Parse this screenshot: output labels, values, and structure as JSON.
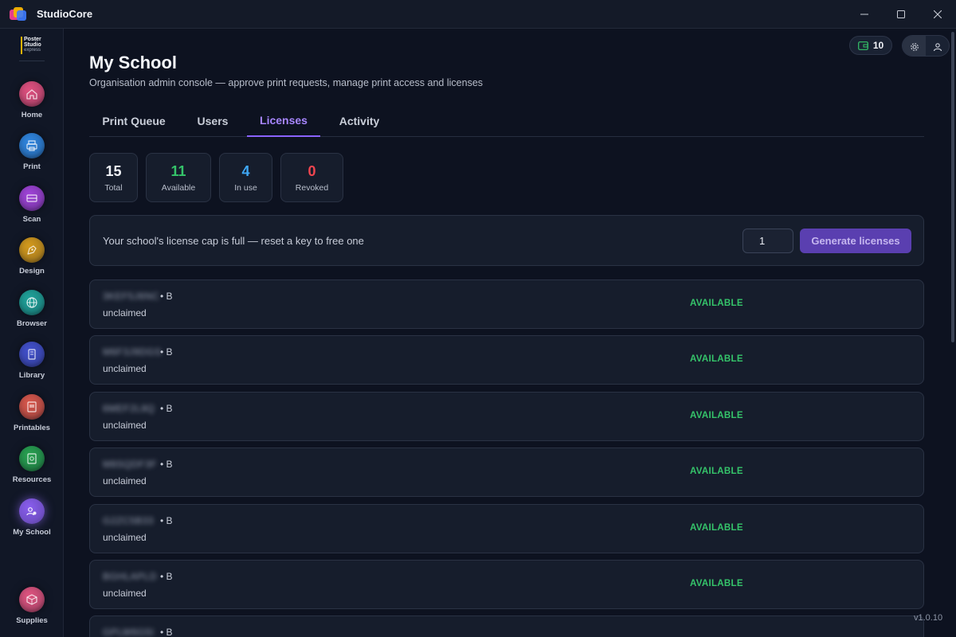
{
  "window": {
    "title": "StudioCore",
    "version": "v1.0.10"
  },
  "brand": {
    "line1": "Poster",
    "line2": "Studio",
    "line3": "express"
  },
  "sidebar": {
    "items": [
      {
        "label": "Home",
        "icon": "home-icon",
        "color": "#e0507f"
      },
      {
        "label": "Print",
        "icon": "printer-icon",
        "color": "#2f86e0"
      },
      {
        "label": "Scan",
        "icon": "scanner-icon",
        "color": "#a043d8"
      },
      {
        "label": "Design",
        "icon": "pen-nib-icon",
        "color": "#d49a1c"
      },
      {
        "label": "Browser",
        "icon": "globe-icon",
        "color": "#1fa39a"
      },
      {
        "label": "Library",
        "icon": "book-icon",
        "color": "#4250cc"
      },
      {
        "label": "Printables",
        "icon": "document-icon",
        "color": "#d9574b"
      },
      {
        "label": "Resources",
        "icon": "resource-icon",
        "color": "#27a150"
      },
      {
        "label": "My School",
        "icon": "school-users-icon",
        "color": "#8a5ef0"
      },
      {
        "label": "Supplies",
        "icon": "box-icon",
        "color": "#e05480"
      }
    ]
  },
  "topbar": {
    "credits": "10"
  },
  "header": {
    "title": "My School",
    "subtitle": "Organisation admin console — approve print requests, manage print access and licenses"
  },
  "tabs": [
    {
      "label": "Print Queue"
    },
    {
      "label": "Users"
    },
    {
      "label": "Licenses"
    },
    {
      "label": "Activity"
    }
  ],
  "stats": [
    {
      "value": "15",
      "label": "Total",
      "color": "#f1f3f8"
    },
    {
      "value": "11",
      "label": "Available",
      "color": "#35c46a"
    },
    {
      "value": "4",
      "label": "In use",
      "color": "#3fa8f5"
    },
    {
      "value": "0",
      "label": "Revoked",
      "color": "#f0454f"
    }
  ],
  "generate": {
    "message": "Your school's license cap is full — reset a key to free one",
    "quantity": "1",
    "button": "Generate licenses"
  },
  "licenses": [
    {
      "key": "3KEF5J6NC",
      "sep": "• B",
      "owner": "unclaimed",
      "status": "AVAILABLE"
    },
    {
      "key": "M6F3J9DGS",
      "sep": "• B",
      "owner": "unclaimed",
      "status": "AVAILABLE"
    },
    {
      "key": "6MEF2L8Q",
      "sep": "• B",
      "owner": "unclaimed",
      "status": "AVAILABLE"
    },
    {
      "key": "M8SQDF3F",
      "sep": "• B",
      "owner": "unclaimed",
      "status": "AVAILABLE"
    },
    {
      "key": "G2ZC5B33",
      "sep": "• B",
      "owner": "unclaimed",
      "status": "AVAILABLE"
    },
    {
      "key": "BGHLAPLD",
      "sep": "• B",
      "owner": "unclaimed",
      "status": "AVAILABLE"
    },
    {
      "key": "GPLW6G5I",
      "sep": "• B",
      "owner": "",
      "status": ""
    }
  ]
}
